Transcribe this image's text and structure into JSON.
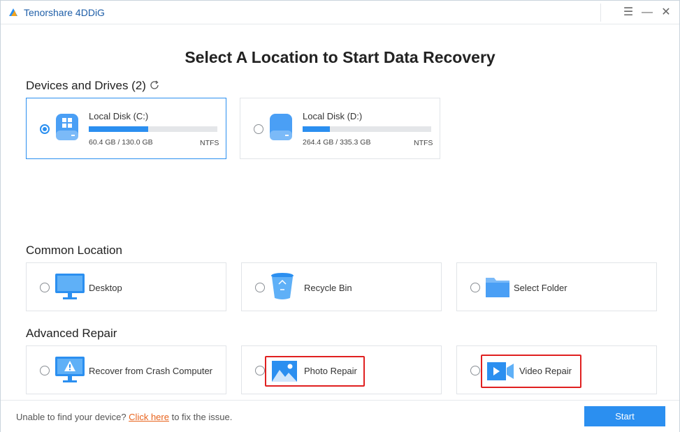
{
  "app": {
    "title": "Tenorshare 4DDiG"
  },
  "window_controls": {
    "menu": "☰",
    "minimize": "—",
    "close": "✕"
  },
  "page_title": "Select A Location to Start Data Recovery",
  "devices": {
    "title": "Devices and Drives (2)",
    "items": [
      {
        "name": "Local Disk (C:)",
        "usage": "60.4 GB / 130.0 GB",
        "fs": "NTFS",
        "used_fraction": 0.46,
        "selected": true
      },
      {
        "name": "Local Disk (D:)",
        "usage": "264.4 GB / 335.3 GB",
        "fs": "NTFS",
        "used_fraction": 0.21,
        "selected": false
      }
    ]
  },
  "common": {
    "title": "Common Location",
    "items": [
      {
        "label": "Desktop",
        "icon": "monitor-icon"
      },
      {
        "label": "Recycle Bin",
        "icon": "recycle-bin-icon"
      },
      {
        "label": "Select Folder",
        "icon": "folder-icon"
      }
    ]
  },
  "advanced": {
    "title": "Advanced Repair",
    "items": [
      {
        "label": "Recover from Crash Computer",
        "icon": "crash-computer-icon"
      },
      {
        "label": "Photo Repair",
        "icon": "photo-icon"
      },
      {
        "label": "Video Repair",
        "icon": "video-icon"
      }
    ]
  },
  "footer": {
    "prefix": "Unable to find your device?",
    "link": "Click here",
    "suffix": "to fix the issue.",
    "start_label": "Start"
  },
  "colors": {
    "accent": "#2b8ff0",
    "highlight": "#e02020",
    "link": "#e8631c",
    "title": "#1f5fa8"
  }
}
